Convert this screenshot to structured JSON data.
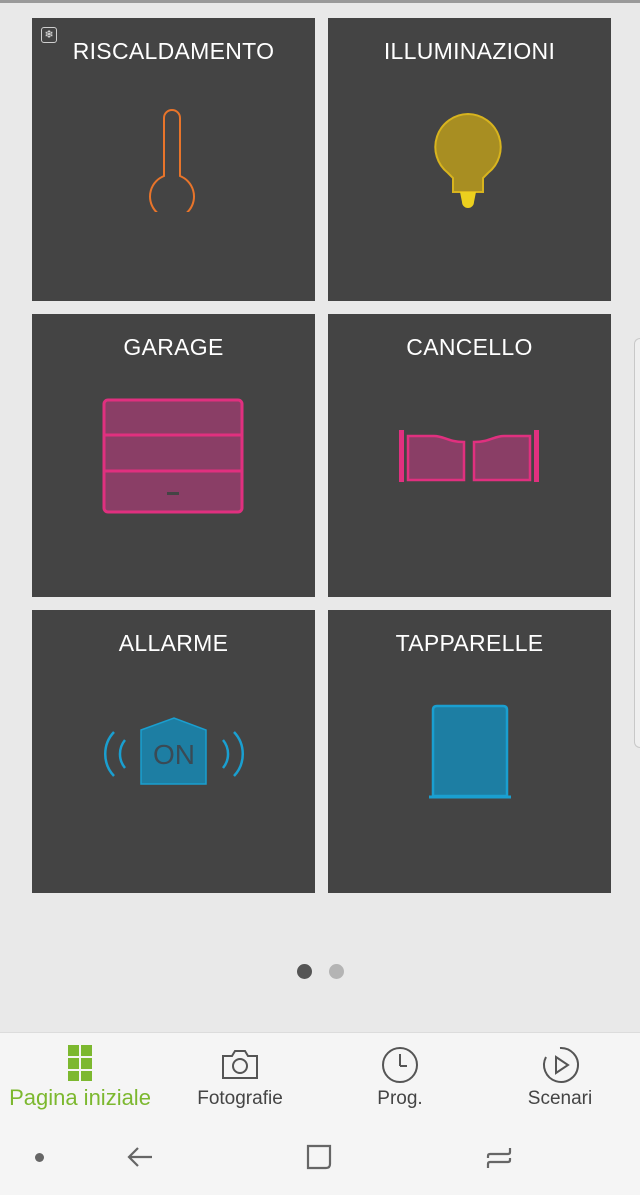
{
  "tiles": [
    {
      "title": "RISCALDAMENTO",
      "icon": "thermometer-icon",
      "badge_icon": "snowflake-icon",
      "color": "#e8742a"
    },
    {
      "title": "ILLUMINAZIONI",
      "icon": "lightbulb-icon",
      "color": "#d8b41e"
    },
    {
      "title": "GARAGE",
      "icon": "garage-door-icon",
      "color": "#e0307f"
    },
    {
      "title": "CANCELLO",
      "icon": "gate-icon",
      "color": "#e0307f"
    },
    {
      "title": "ALLARME",
      "icon": "alarm-icon",
      "icon_text": "ON",
      "color": "#1a9fd0"
    },
    {
      "title": "TAPPARELLE",
      "icon": "shutter-icon",
      "color": "#1a9fd0"
    }
  ],
  "pager": {
    "pages": 2,
    "current": 1
  },
  "bottom_nav": [
    {
      "label": "Pagina iniziale",
      "icon": "grid-icon",
      "active": true
    },
    {
      "label": "Fotografie",
      "icon": "camera-icon",
      "active": false
    },
    {
      "label": "Prog.",
      "icon": "clock-icon",
      "active": false
    },
    {
      "label": "Scenari",
      "icon": "play-circle-icon",
      "active": false
    }
  ],
  "system_nav": [
    "dot",
    "back-icon",
    "home-icon",
    "recents-icon"
  ],
  "colors": {
    "tile_bg": "#444444",
    "page_bg": "#e9e9e9",
    "accent": "#7cb82f"
  }
}
